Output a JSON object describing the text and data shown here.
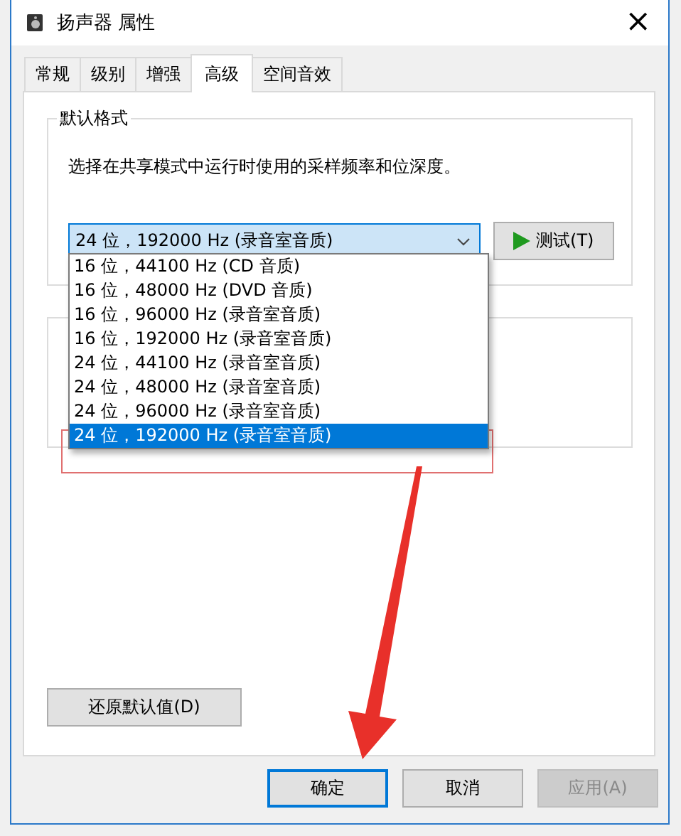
{
  "window": {
    "title": "扬声器 属性",
    "close": "×"
  },
  "tabs": [
    {
      "label": "常规",
      "selected": false
    },
    {
      "label": "级别",
      "selected": false
    },
    {
      "label": "增强",
      "selected": false
    },
    {
      "label": "高级",
      "selected": true
    },
    {
      "label": "空间音效",
      "selected": false
    }
  ],
  "default_format": {
    "title": "默认格式",
    "description": "选择在共享模式中运行时使用的采样频率和位深度。",
    "value": "24 位，192000 Hz (录音室音质)",
    "test_button": "测试(T)",
    "options": [
      {
        "label": "16 位，44100 Hz (CD 音质)",
        "selected": false
      },
      {
        "label": "16 位，48000 Hz (DVD 音质)",
        "selected": false
      },
      {
        "label": "16 位，96000 Hz (录音室音质)",
        "selected": false
      },
      {
        "label": "16 位，192000 Hz (录音室音质)",
        "selected": false
      },
      {
        "label": "24 位，44100 Hz (录音室音质)",
        "selected": false
      },
      {
        "label": "24 位，48000 Hz (录音室音质)",
        "selected": false
      },
      {
        "label": "24 位，96000 Hz (录音室音质)",
        "selected": false
      },
      {
        "label": "24 位，192000 Hz (录音室音质)",
        "selected": true
      }
    ]
  },
  "restore_button": "还原默认值(D)",
  "buttons": [
    {
      "label": "确定",
      "disabled": false,
      "default": true
    },
    {
      "label": "取消",
      "disabled": false,
      "default": false
    },
    {
      "label": "应用(A)",
      "disabled": true,
      "default": false
    }
  ]
}
